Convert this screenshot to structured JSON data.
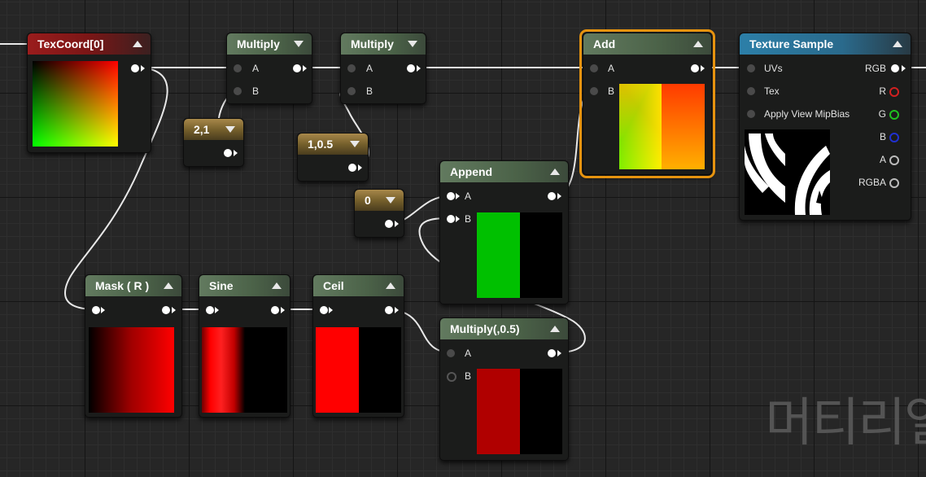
{
  "nodes": {
    "texcoord": {
      "title": "TexCoord[0]"
    },
    "multiply1": {
      "title": "Multiply",
      "pin_a": "A",
      "pin_b": "B"
    },
    "multiply2": {
      "title": "Multiply",
      "pin_a": "A",
      "pin_b": "B"
    },
    "const21": {
      "title": "2,1"
    },
    "const105": {
      "title": "1,0.5"
    },
    "const0": {
      "title": "0"
    },
    "add": {
      "title": "Add",
      "pin_a": "A",
      "pin_b": "B"
    },
    "texture_sample": {
      "title": "Texture Sample",
      "inputs": [
        "UVs",
        "Tex",
        "Apply View MipBias"
      ],
      "outputs": [
        "RGB",
        "R",
        "G",
        "B",
        "A",
        "RGBA"
      ]
    },
    "append": {
      "title": "Append",
      "pin_a": "A",
      "pin_b": "B"
    },
    "mask": {
      "title": "Mask ( R )"
    },
    "sine": {
      "title": "Sine"
    },
    "ceil": {
      "title": "Ceil"
    },
    "multiply3": {
      "title": "Multiply(,0.5)",
      "pin_a": "A",
      "pin_b": "B"
    }
  },
  "colors": {
    "selected_outline": "#e6930f",
    "pin_r": "#d02020",
    "pin_g": "#20c020",
    "pin_b": "#2030d0"
  },
  "watermark": "머티리얼"
}
